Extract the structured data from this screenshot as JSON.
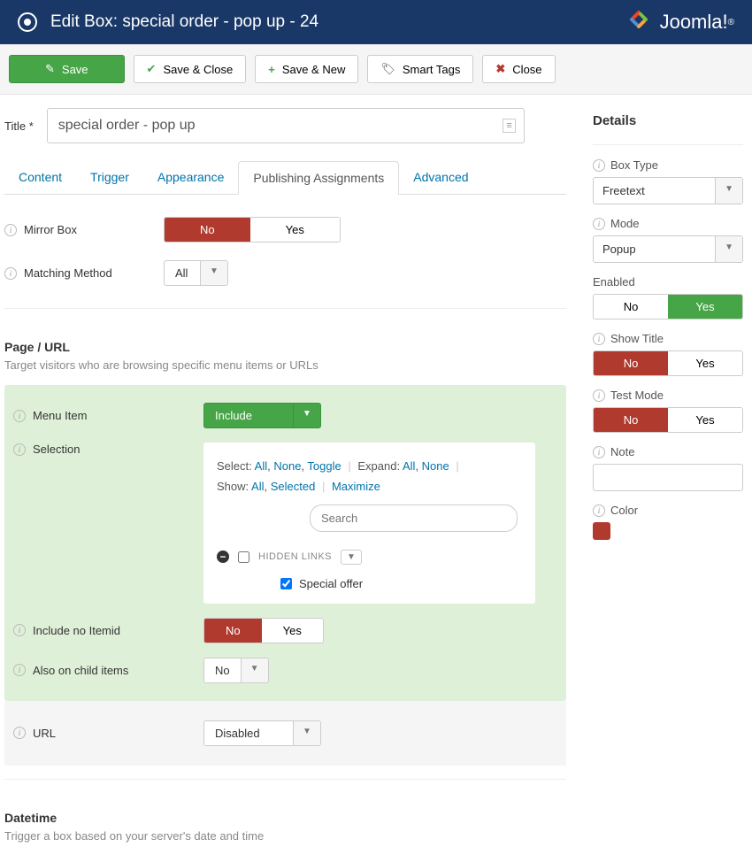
{
  "header": {
    "title": "Edit Box: special order - pop up - 24",
    "brand": "Joomla!"
  },
  "toolbar": {
    "save": "Save",
    "save_close": "Save & Close",
    "save_new": "Save & New",
    "smart_tags": "Smart Tags",
    "close": "Close"
  },
  "title_field": {
    "label": "Title *",
    "value": "special order - pop up"
  },
  "tabs": {
    "content": "Content",
    "trigger": "Trigger",
    "appearance": "Appearance",
    "publishing": "Publishing Assignments",
    "advanced": "Advanced"
  },
  "mirror": {
    "label": "Mirror Box",
    "no": "No",
    "yes": "Yes"
  },
  "matching": {
    "label": "Matching Method",
    "value": "All"
  },
  "page_url": {
    "heading": "Page / URL",
    "desc": "Target visitors who are browsing specific menu items or URLs"
  },
  "menu_item": {
    "label": "Menu Item",
    "value": "Include"
  },
  "selection": {
    "label": "Selection",
    "select_label": "Select:",
    "all": "All",
    "none": "None",
    "toggle": "Toggle",
    "expand_label": "Expand:",
    "exp_all": "All",
    "exp_none": "None",
    "show_label": "Show:",
    "show_all": "All",
    "show_selected": "Selected",
    "maximize": "Maximize",
    "search_ph": "Search",
    "hidden": "HIDDEN LINKS",
    "special_offer": "Special offer"
  },
  "include_no_itemid": {
    "label": "Include no Itemid",
    "no": "No",
    "yes": "Yes"
  },
  "also_child": {
    "label": "Also on child items",
    "value": "No"
  },
  "url_field": {
    "label": "URL",
    "value": "Disabled"
  },
  "datetime": {
    "heading": "Datetime",
    "desc": "Trigger a box based on your server's date and time"
  },
  "details": {
    "heading": "Details",
    "box_type": {
      "label": "Box Type",
      "value": "Freetext"
    },
    "mode": {
      "label": "Mode",
      "value": "Popup"
    },
    "enabled": {
      "label": "Enabled",
      "no": "No",
      "yes": "Yes"
    },
    "show_title": {
      "label": "Show Title",
      "no": "No",
      "yes": "Yes"
    },
    "test_mode": {
      "label": "Test Mode",
      "no": "No",
      "yes": "Yes"
    },
    "note": {
      "label": "Note"
    },
    "color": {
      "label": "Color",
      "value": "#b13a2e"
    }
  }
}
